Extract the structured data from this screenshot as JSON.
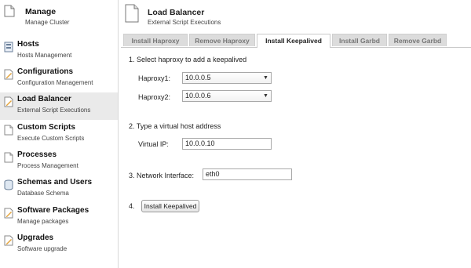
{
  "sidebar": {
    "items": [
      {
        "title": "Manage",
        "sub": "Manage Cluster",
        "icon": "page-icon"
      },
      {
        "title": "Hosts",
        "sub": "Hosts Management",
        "icon": "hosts-icon"
      },
      {
        "title": "Configurations",
        "sub": "Configuration Management",
        "icon": "edit-page-icon"
      },
      {
        "title": "Load Balancer",
        "sub": "External Script Executions",
        "icon": "edit-page-icon"
      },
      {
        "title": "Custom Scripts",
        "sub": "Execute Custom Scripts",
        "icon": "page-icon"
      },
      {
        "title": "Processes",
        "sub": "Process Management",
        "icon": "page-icon"
      },
      {
        "title": "Schemas and Users",
        "sub": "Database Schema",
        "icon": "database-icon"
      },
      {
        "title": "Software Packages",
        "sub": "Manage packages",
        "icon": "edit-page-icon"
      },
      {
        "title": "Upgrades",
        "sub": "Software upgrade",
        "icon": "edit-page-icon"
      }
    ],
    "active_index": 3
  },
  "header": {
    "title": "Load Balancer",
    "subtitle": "External Script Executions",
    "icon": "page-icon"
  },
  "tabs": [
    {
      "label": "Install Haproxy",
      "active": false
    },
    {
      "label": "Remove Haproxy",
      "active": false
    },
    {
      "label": "Install Keepalived",
      "active": true
    },
    {
      "label": "Install Garbd",
      "active": false
    },
    {
      "label": "Remove Garbd",
      "active": false
    }
  ],
  "form": {
    "step1": "1. Select haproxy to add a keepalived",
    "haproxy1_label": "Haproxy1:",
    "haproxy1_value": "10.0.0.5",
    "haproxy2_label": "Haproxy2:",
    "haproxy2_value": "10.0.0.6",
    "step2": "2. Type a virtual host address",
    "vip_label": "Virtual IP:",
    "vip_value": "10.0.0.10",
    "iface_label": "3. Network Interface:",
    "iface_value": "eth0",
    "step4": "4.",
    "install_button": "Install Keepalived"
  },
  "colors": {
    "sidebar_active_bg": "#eaeaea",
    "tab_inactive_bg": "#dcdcdc",
    "tab_active_bg": "#ffffff"
  }
}
